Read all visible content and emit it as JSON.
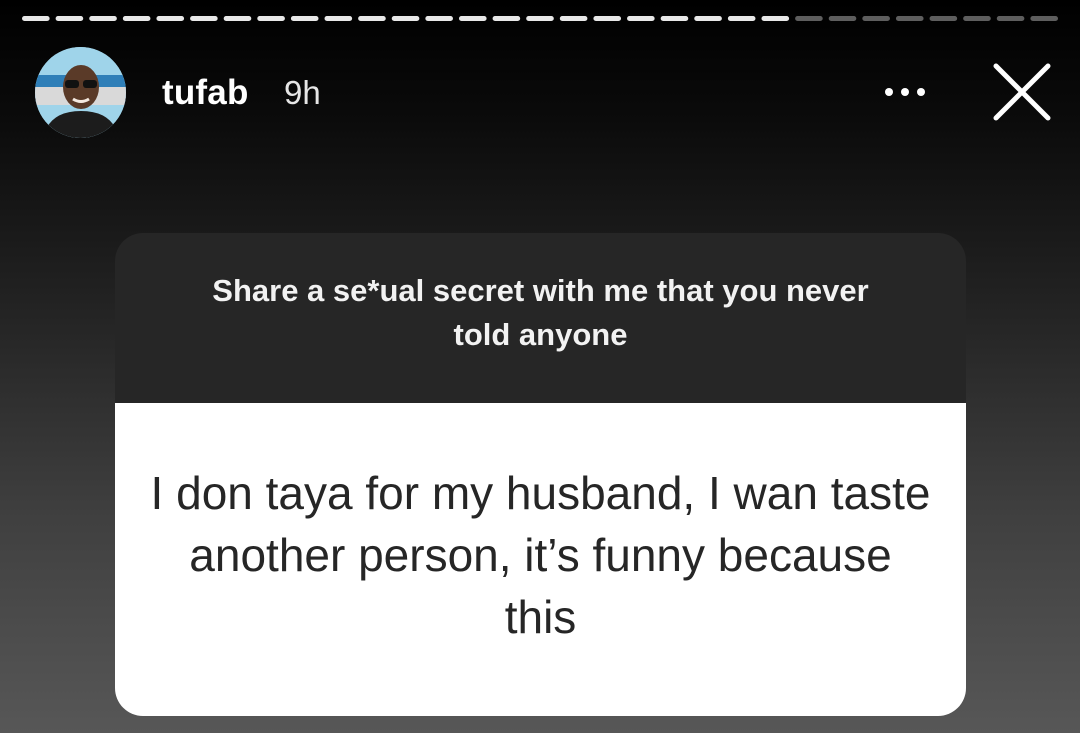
{
  "story": {
    "progress_fraction": 0.74,
    "segment_count": 31,
    "colors": {
      "segment_viewed": "#e8e8e8",
      "segment_unviewed": "#5e5e5e"
    }
  },
  "header": {
    "username": "tufab",
    "timestamp": "9h",
    "more_icon": "more-horizontal-icon",
    "close_icon": "close-icon"
  },
  "question_card": {
    "question": "Share a se*ual secret with me that you never told anyone",
    "answer": "I don taya for my husband, I wan taste another person, it’s funny because this"
  }
}
